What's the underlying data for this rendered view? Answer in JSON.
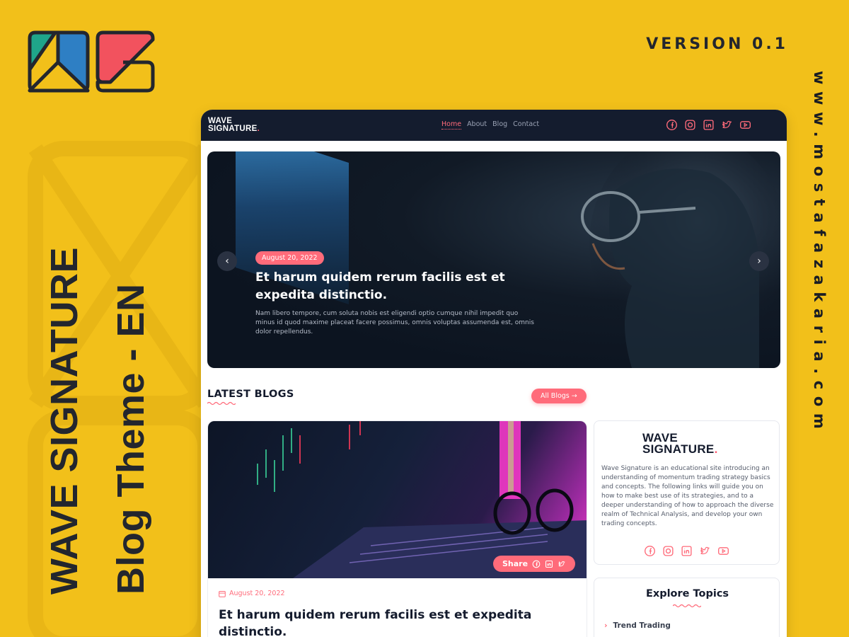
{
  "version_label": "VERSION 0.1",
  "side_url": "www.mostafazakaria.com",
  "side_title": {
    "line1": "WAVE SIGNATURE",
    "line2": "Blog Theme - EN"
  },
  "site": {
    "brand_line1": "WAVE",
    "brand_line2": "SIGNATURE",
    "brand_dot": ".",
    "nav": [
      "Home",
      "About",
      "Blog",
      "Contact"
    ],
    "active_nav": "Home",
    "social_icons": [
      "facebook-icon",
      "instagram-icon",
      "linkedin-icon",
      "twitter-icon",
      "youtube-icon"
    ]
  },
  "hero": {
    "date": "August 20, 2022",
    "title": "Et harum quidem rerum facilis est et expedita distinctio.",
    "text": "Nam libero tempore, cum soluta nobis est eligendi optio cumque nihil impedit quo minus id quod maxime placeat facere possimus, omnis voluptas assumenda est, omnis dolor repellendus.",
    "prev_arrow": "‹",
    "next_arrow": "›"
  },
  "latest": {
    "title": "LATEST BLOGS",
    "all_blogs_label": "All Blogs →"
  },
  "card": {
    "share_label": "Share",
    "date": "August 20, 2022",
    "title": "Et harum quidem rerum facilis est et expedita distinctio."
  },
  "about": {
    "logo_line1": "WAVE",
    "logo_line2": "SIGNATURE",
    "text": "Wave Signature is an educational site introducing an understanding of momentum trading strategy basics and concepts. The following links will guide you on how to make best use of its strategies, and to a deeper understanding of how to approach the diverse realm of Technical Analysis, and develop your own trading concepts."
  },
  "topics": {
    "title": "Explore Topics",
    "first_item": "Trend Trading",
    "chevron": "›"
  },
  "colors": {
    "background": "#F2C01A",
    "navy": "#141C2E",
    "accent": "#FF6B7A",
    "logo_teal": "#1FA58A",
    "logo_blue": "#2E7FC4",
    "logo_red": "#F2525E"
  }
}
